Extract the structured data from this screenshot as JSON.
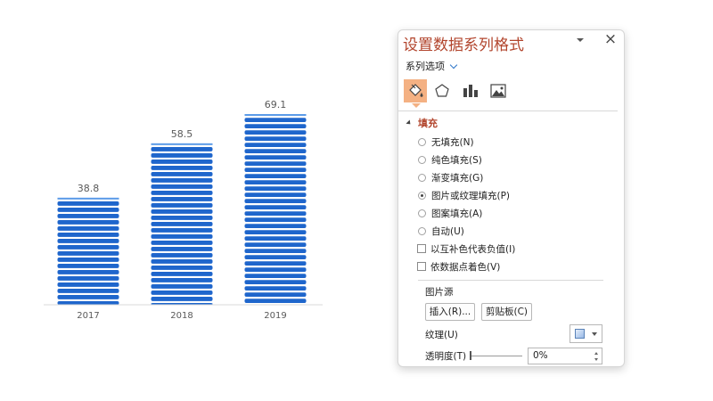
{
  "chart_data": {
    "type": "bar",
    "categories": [
      "2017",
      "2018",
      "2019"
    ],
    "values": [
      38.8,
      58.5,
      69.1
    ],
    "data_labels": [
      "38.8",
      "58.5",
      "69.1"
    ],
    "title": "",
    "xlabel": "",
    "ylabel": "",
    "ylim": [
      0,
      69.1
    ],
    "grid": false,
    "legend": "none",
    "fill": "picture-or-texture (stacked stripes)",
    "bar_color": "#1f66cc",
    "bar_top_color": "#5b9be8"
  },
  "pane": {
    "title": "设置数据系列格式",
    "close_label": "×",
    "series_options_label": "系列选项",
    "section_fill_label": "填充",
    "fill_options": [
      {
        "label": "无填充(N)",
        "checked": false
      },
      {
        "label": "纯色填充(S)",
        "checked": false
      },
      {
        "label": "渐变填充(G)",
        "checked": false
      },
      {
        "label": "图片或纹理填充(P)",
        "checked": true
      },
      {
        "label": "图案填充(A)",
        "checked": false
      },
      {
        "label": "自动(U)",
        "checked": false
      }
    ],
    "invert_negative_label": "以互补色代表负值(I)",
    "vary_colors_label": "依数据点着色(V)",
    "picture_source_label": "图片源",
    "insert_button": "插入(R)...",
    "clipboard_button": "剪贴板(C)",
    "texture_label": "纹理(U)",
    "transparency_label": "透明度(T)",
    "transparency_value": "0%",
    "accent_color": "#b2452d",
    "active_tab_color": "#f4b183"
  }
}
